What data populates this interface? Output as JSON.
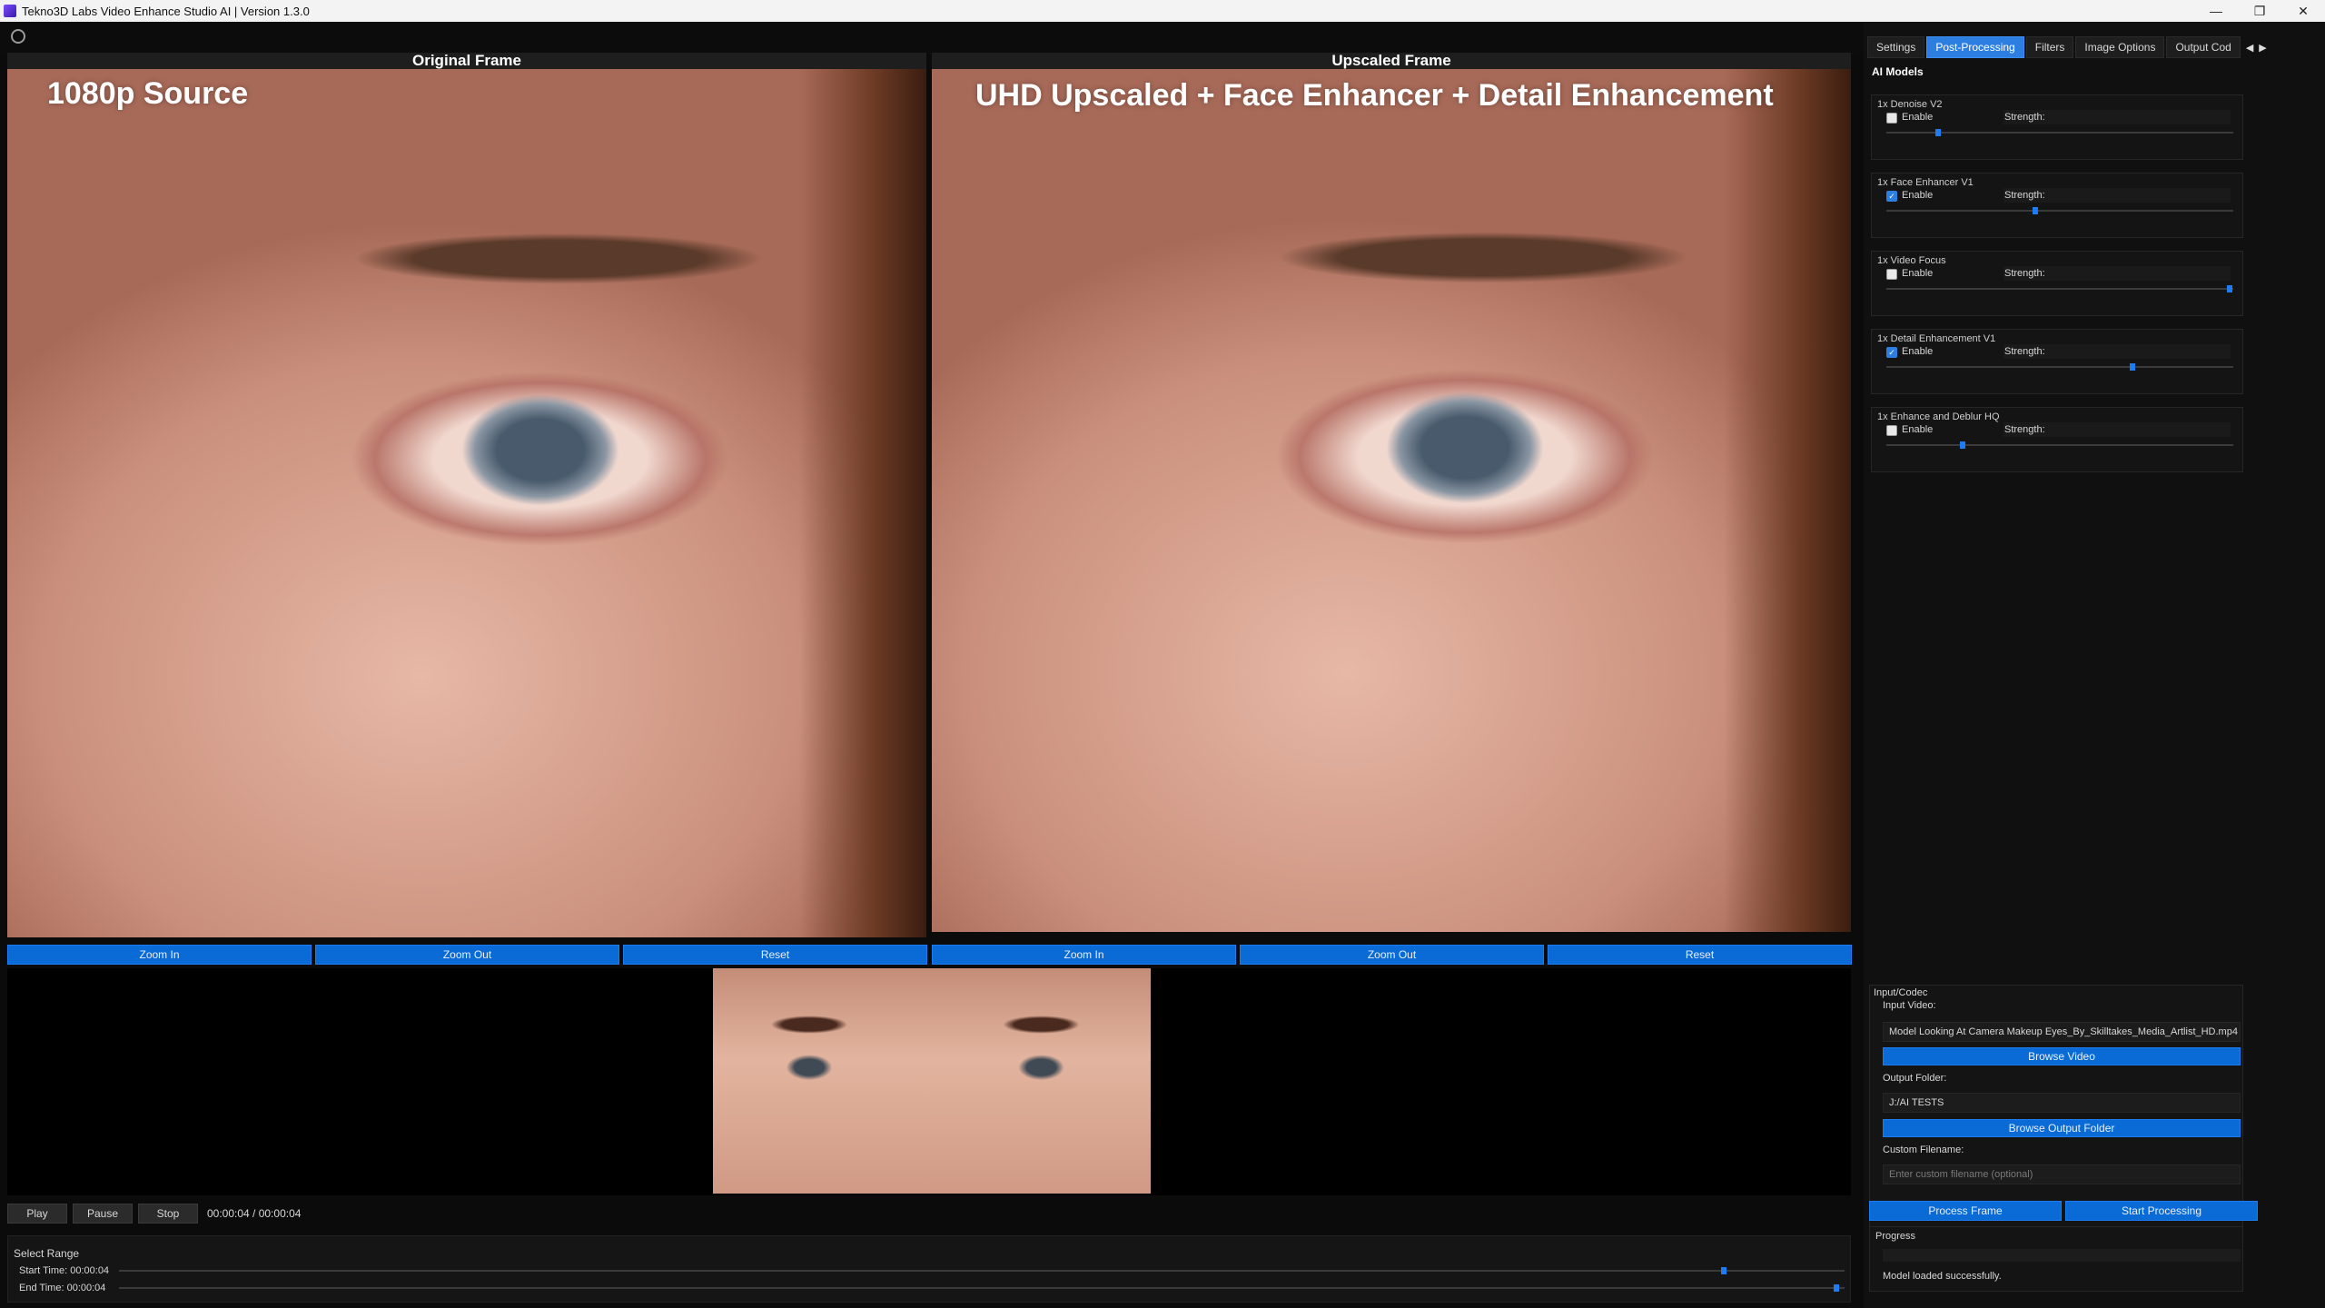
{
  "window": {
    "title": "Tekno3D Labs Video Enhance Studio AI | Version 1.3.0",
    "minimize": "—",
    "restore": "❐",
    "close": "✕"
  },
  "frames": {
    "left": {
      "label": "Original Frame",
      "overlay": "1080p Source"
    },
    "right": {
      "label": "Upscaled Frame",
      "overlay": "UHD Upscaled + Face Enhancer + Detail Enhancement"
    }
  },
  "zoom_left": {
    "zoom_in": "Zoom In",
    "zoom_out": "Zoom Out",
    "reset": "Reset"
  },
  "zoom_right": {
    "zoom_in": "Zoom In",
    "zoom_out": "Zoom Out",
    "reset": "Reset"
  },
  "transport": {
    "play": "Play",
    "pause": "Pause",
    "stop": "Stop",
    "time": "00:00:04 / 00:00:04"
  },
  "range": {
    "title": "Select Range",
    "start_label": "Start Time: 00:00:04",
    "end_label": "End Time: 00:00:04",
    "start_fraction": 0.93,
    "end_fraction": 0.995
  },
  "tabs": [
    {
      "label": "Settings",
      "active": false
    },
    {
      "label": "Post-Processing",
      "active": true
    },
    {
      "label": "Filters",
      "active": false
    },
    {
      "label": "Image Options",
      "active": false
    },
    {
      "label": "Output Cod",
      "active": false
    }
  ],
  "ai_models": {
    "title": "AI Models",
    "enable_label": "Enable",
    "strength_label": "Strength:",
    "items": [
      {
        "name": "1x Denoise V2",
        "enabled": false,
        "strength": 0.15
      },
      {
        "name": "1x Face Enhancer V1",
        "enabled": true,
        "strength": 0.43
      },
      {
        "name": "1x Video Focus",
        "enabled": false,
        "strength": 0.99
      },
      {
        "name": "1x Detail Enhancement V1",
        "enabled": true,
        "strength": 0.71
      },
      {
        "name": "1x Enhance and Deblur HQ",
        "enabled": false,
        "strength": 0.22
      }
    ]
  },
  "io": {
    "title": "Input/Codec",
    "input_label": "Input Video:",
    "input_value": "Model Looking At Camera Makeup Eyes_By_Skilltakes_Media_Artlist_HD.mp4",
    "browse_video": "Browse Video",
    "output_label": "Output Folder:",
    "output_value": "J:/AI TESTS",
    "browse_output": "Browse Output Folder",
    "custom_label": "Custom Filename:",
    "custom_placeholder": "Enter custom filename (optional)"
  },
  "actions": {
    "process_frame": "Process Frame",
    "start_processing": "Start Processing"
  },
  "progress": {
    "title": "Progress",
    "message": "Model loaded successfully."
  },
  "colors": {
    "accent": "#0a6ad6",
    "tab_active": "#2c7fe0"
  }
}
